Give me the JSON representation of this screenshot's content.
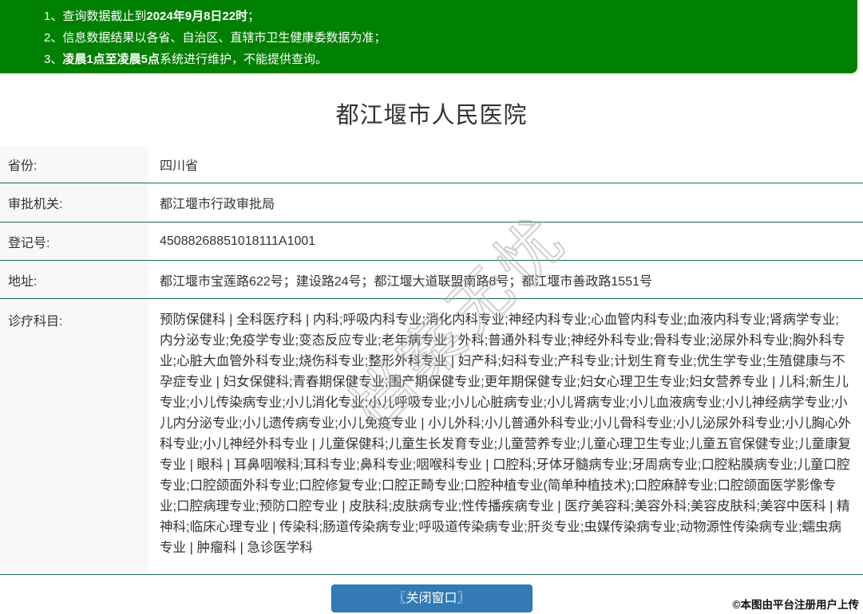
{
  "banner": {
    "notices": [
      {
        "num": "1、",
        "pre": "查询数据截止到",
        "bold": "2024年9月8日22时",
        "post": "；"
      },
      {
        "num": "2、",
        "pre": "信息数据结果以各省、自治区、直辖市卫生健康委数据为准；",
        "bold": "",
        "post": ""
      },
      {
        "num": "3、",
        "pre": "",
        "bold": "凌晨1点至凌晨5点",
        "post": "系统进行维护，不能提供查询。"
      }
    ],
    "bg_color": "#008000"
  },
  "page_title": "都江堰市人民医院",
  "info_table": {
    "rows": [
      {
        "label": "省份:",
        "value": "四川省"
      },
      {
        "label": "审批机关:",
        "value": "都江堰市行政审批局"
      },
      {
        "label": "登记号:",
        "value": "45088268851018111A1001"
      },
      {
        "label": "地址:",
        "value": "都江堰市宝莲路622号；建设路24号；都江堰大道联盟南路8号；都江堰市善政路1551号"
      },
      {
        "label": "诊疗科目:",
        "value": "预防保健科 | 全科医疗科 | 内科;呼吸内科专业;消化内科专业;神经内科专业;心血管内科专业;血液内科专业;肾病学专业;内分泌专业;免疫学专业;变态反应专业;老年病专业 | 外科;普通外科专业;神经外科专业;骨科专业;泌尿外科专业;胸外科专业;心脏大血管外科专业;烧伤科专业;整形外科专业 | 妇产科;妇科专业;产科专业;计划生育专业;优生学专业;生殖健康与不孕症专业 | 妇女保健科;青春期保健专业;围产期保健专业;更年期保健专业;妇女心理卫生专业;妇女营养专业 | 儿科;新生儿专业;小儿传染病专业;小儿消化专业;小儿呼吸专业;小儿心脏病专业;小儿肾病专业;小儿血液病专业;小儿神经病学专业;小儿内分泌专业;小儿遗传病专业;小儿免疫专业 | 小儿外科;小儿普通外科专业;小儿骨科专业;小儿泌尿外科专业;小儿胸心外科专业;小儿神经外科专业 | 儿童保健科;儿童生长发育专业;儿童营养专业;儿童心理卫生专业;儿童五官保健专业;儿童康复专业 | 眼科 | 耳鼻咽喉科;耳科专业;鼻科专业;咽喉科专业 | 口腔科;牙体牙髓病专业;牙周病专业;口腔粘膜病专业;儿童口腔专业;口腔颌面外科专业;口腔修复专业;口腔正畸专业;口腔种植专业(简单种植技术);口腔麻醉专业;口腔颌面医学影像专业;口腔病理专业;预防口腔专业 | 皮肤科;皮肤病专业;性传播疾病专业 | 医疗美容科;美容外科;美容皮肤科;美容中医科 | 精神科;临床心理专业 | 传染科;肠道传染病专业;呼吸道传染病专业;肝炎专业;虫媒传染病专业;动物源性传染病专业;蠕虫病专业 | 肿瘤科 | 急诊医学科"
      }
    ]
  },
  "watermark": {
    "text": "档案无忧"
  },
  "footer": {
    "close_button_label": "〖关闭窗口〗",
    "credit": "©本图由平台注册用户上传"
  },
  "colors": {
    "banner_green": "#008000",
    "row_border_green": "#1b6d44",
    "label_bg": "#f8f8f8",
    "button_blue": "#337ab7"
  }
}
